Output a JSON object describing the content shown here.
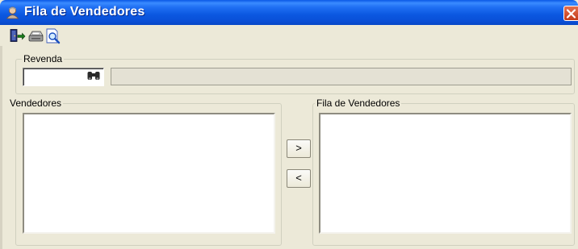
{
  "window": {
    "title": "Fila de Vendedores",
    "title_icon": "user-avatar-icon",
    "close_icon": "close-icon"
  },
  "toolbar": {
    "items": [
      {
        "name": "exit-door-icon"
      },
      {
        "name": "printer-icon"
      },
      {
        "name": "print-preview-icon"
      }
    ]
  },
  "revenda": {
    "label": "Revenda",
    "code_value": "",
    "name_value": "",
    "search_icon": "binoculars-icon"
  },
  "vendedores": {
    "label": "Vendedores",
    "items": []
  },
  "fila": {
    "label": "Fila de Vendedores",
    "items": []
  },
  "buttons": {
    "add_label": ">",
    "remove_label": "<"
  },
  "colors": {
    "titlebar": "#0a58e6",
    "window_bg": "#ece9d8",
    "close_button": "#d6502c"
  }
}
